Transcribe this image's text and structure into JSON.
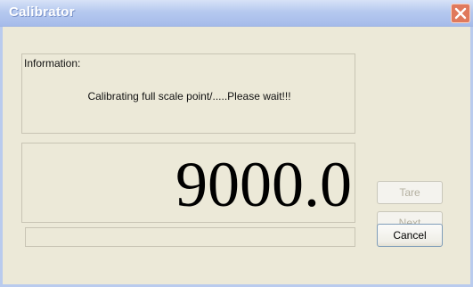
{
  "window": {
    "title": "Calibrator"
  },
  "info": {
    "label": "Information:",
    "message": "Calibrating full scale point/.....Please wait!!!"
  },
  "display": {
    "value": "9000.0"
  },
  "buttons": {
    "tare": "Tare",
    "next": "Next",
    "cancel": "Cancel"
  },
  "colors": {
    "titlebar": "#b6c9ef",
    "close_button": "#e0795c",
    "window_background": "#ece9d8"
  },
  "icons": {
    "close": "close-icon"
  }
}
